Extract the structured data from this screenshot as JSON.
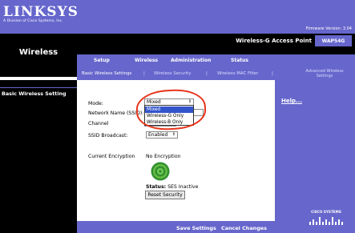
{
  "banner": {
    "logo": "LINKSYS",
    "logo_sub": "A Division of Cisco Systems, Inc.",
    "firmware": "Firmware Version: 3.04"
  },
  "header": {
    "section_title": "Wireless",
    "product": "Wireless-G Access Point",
    "model": "WAP54G"
  },
  "tabs": [
    "Setup",
    "Wireless",
    "Administration",
    "Status"
  ],
  "subtabs": [
    "Basic Wireless Settings",
    "Wireless Security",
    "Wireless MAC Filter"
  ],
  "subtab_separator": "|",
  "subtab_advanced": "Advanced Wireless Settings",
  "left": {
    "label": "Basic Wireless Setting"
  },
  "form": {
    "mode_label": "Mode:",
    "mode_value": "Mixed",
    "mode_options": [
      "Mixed",
      "Wireless-G Only",
      "Wireless-B Only"
    ],
    "ssid_label": "Network Name (SSID):",
    "channel_label": "Channel",
    "ssid_broadcast_label": "SSID Broadcast:",
    "ssid_broadcast_value": "Enabled",
    "encryption_label": "Current Encryption",
    "encryption_value": "No Encryption",
    "status_label": "Status:",
    "status_value": "SES Inactive",
    "reset_security": "Reset Security"
  },
  "help": "Help...",
  "bottom": {
    "save": "Save Settings",
    "cancel": "Cancel Changes"
  },
  "cisco": "CISCO SYSTEMS",
  "colors": {
    "purple": "#6666cc",
    "black": "#000000",
    "annotation": "#e8341c",
    "highlight": "#3355cc"
  }
}
